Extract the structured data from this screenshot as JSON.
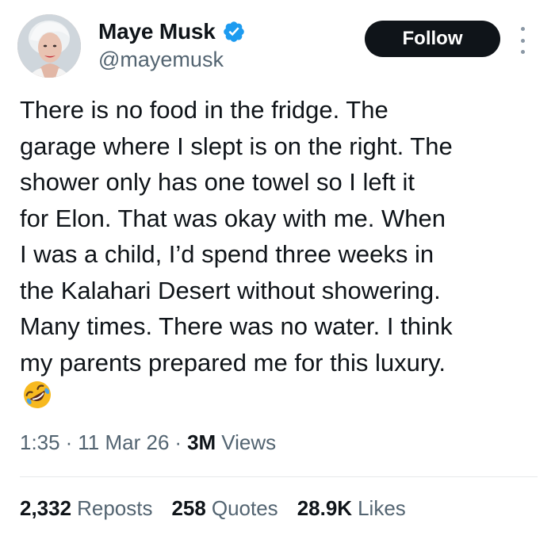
{
  "author": {
    "display_name": "Maye Musk",
    "handle": "@mayemusk",
    "verified": true,
    "avatar_icon": "profile-photo"
  },
  "follow_label": "Follow",
  "tweet": {
    "text": "There is no food in the fridge. The\ngarage where I slept is on the right. The\nshower only has one towel so I left it\nfor Elon. That was okay with me. When\nI was a child, I’d spend three weeks in\nthe Kalahari Desert without showering.\nMany times. There was no water. I think\nmy parents prepared me for this luxury.",
    "emoji_icon": "rolling-on-floor-laughing-emoji"
  },
  "meta": {
    "time": "1:35",
    "separator": "·",
    "date": "11 Mar 26",
    "views_count": "3M",
    "views_label": "Views"
  },
  "stats": {
    "reposts_count": "2,332",
    "reposts_label": "Reposts",
    "quotes_count": "258",
    "quotes_label": "Quotes",
    "likes_count": "28.9K",
    "likes_label": "Likes"
  },
  "colors": {
    "text_primary": "#0f1419",
    "text_secondary": "#536471",
    "verified_blue": "#1d9bf0",
    "follow_bg": "#0f1419"
  }
}
